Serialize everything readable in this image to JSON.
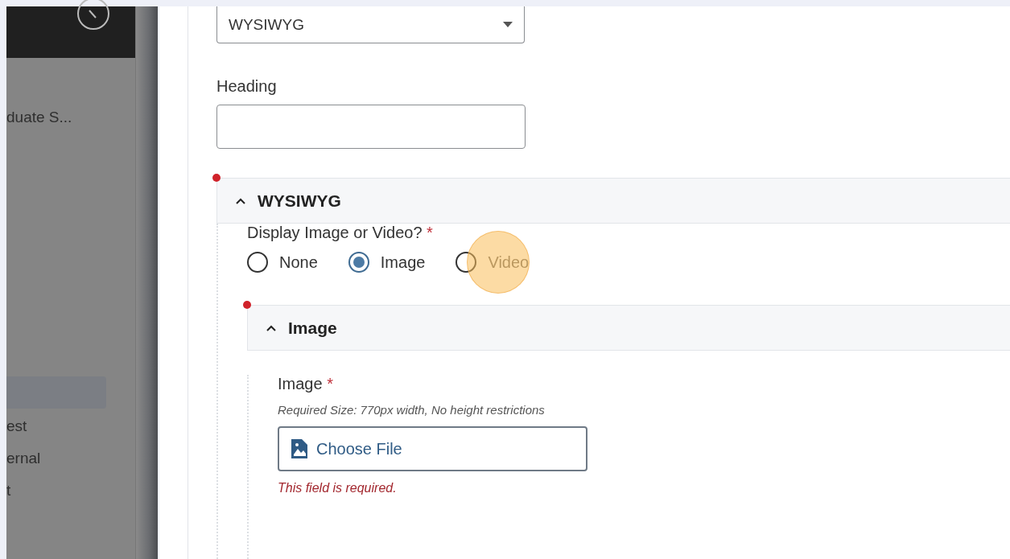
{
  "sidebar": {
    "items": [
      {
        "label": "duate S...",
        "selected": false
      },
      {
        "selected": true
      },
      {
        "label": "est",
        "selected": false
      },
      {
        "label": "ernal",
        "selected": false
      },
      {
        "label": "t",
        "selected": false
      }
    ]
  },
  "form": {
    "type_select": {
      "value": "WYSIWYG"
    },
    "heading_field": {
      "label": "Heading"
    },
    "section": {
      "title": "WYSIWYG",
      "expanded": true,
      "display_choice": {
        "label": "Display Image or Video?",
        "required_mark": "*",
        "options": [
          {
            "label": "None",
            "selected": false,
            "click_marker": false
          },
          {
            "label": "Image",
            "selected": true,
            "click_marker": false
          },
          {
            "label": "Video",
            "selected": false,
            "click_marker": true
          }
        ]
      },
      "subsection": {
        "title": "Image",
        "expanded": true,
        "image_field": {
          "label": "Image",
          "required_mark": "*",
          "hint": "Required Size: 770px width, No height restrictions",
          "button": "Choose File",
          "error": "This field is required."
        }
      }
    }
  }
}
